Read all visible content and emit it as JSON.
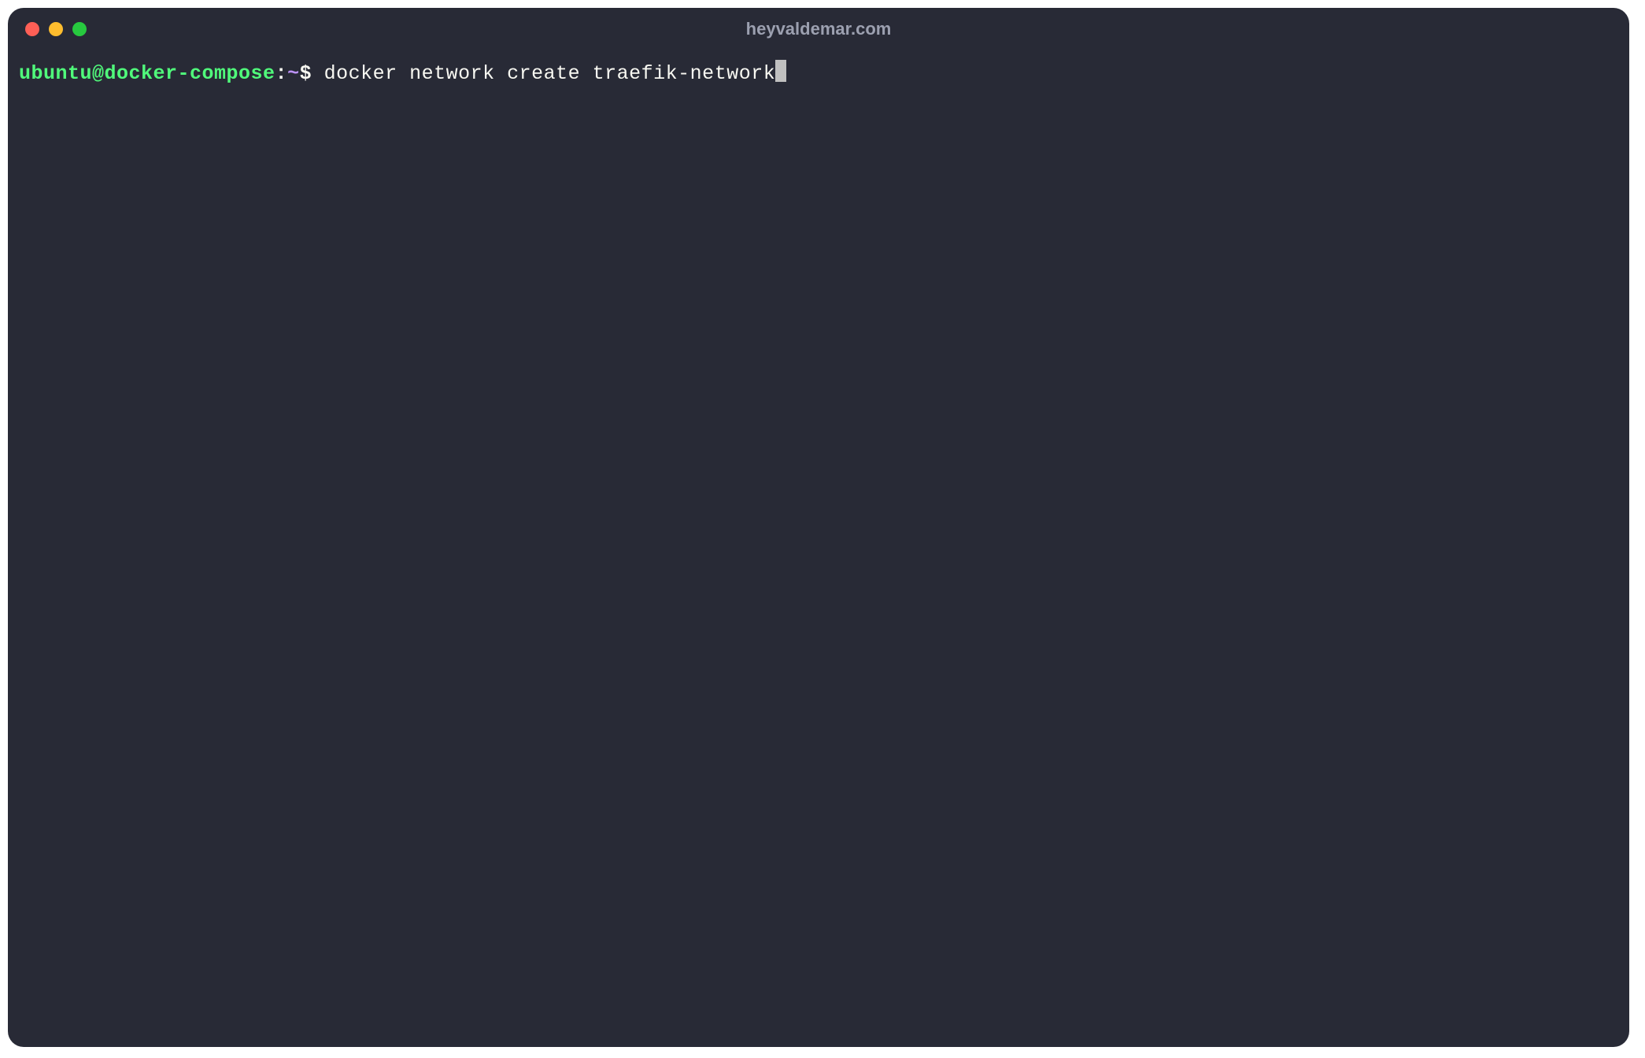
{
  "window": {
    "title": "heyvaldemar.com"
  },
  "prompt": {
    "user_host": "ubuntu@docker-compose",
    "colon": ":",
    "path": "~",
    "symbol": "$ "
  },
  "command": "docker network create traefik-network",
  "traffic_lights": {
    "red": "close",
    "yellow": "minimize",
    "green": "maximize"
  }
}
